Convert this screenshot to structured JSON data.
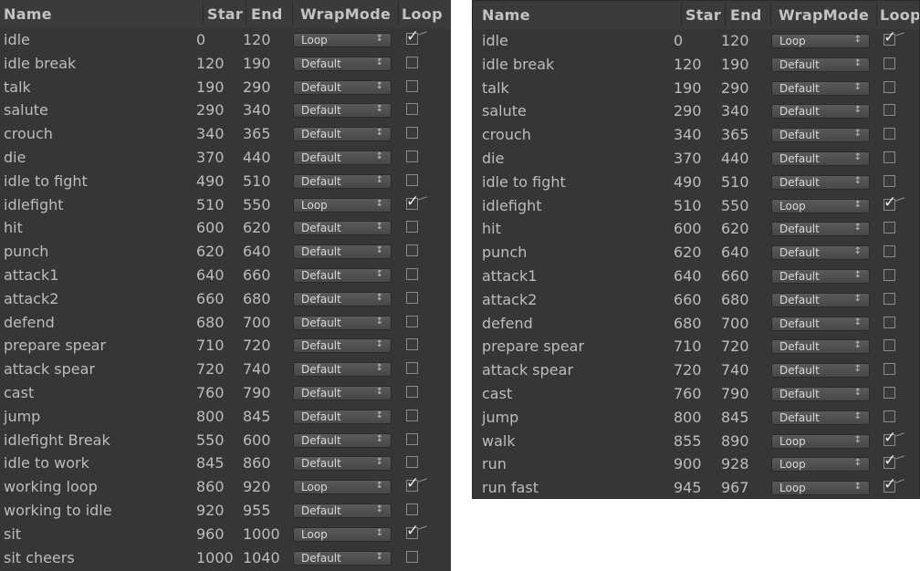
{
  "headers": {
    "name": "Name",
    "start": "Star",
    "end": "End",
    "wrapmode": "WrapMode",
    "loop": "Loop"
  },
  "left_rows": [
    {
      "name": "idle",
      "start": "0",
      "end": "120",
      "wrap": "Loop",
      "loop": true
    },
    {
      "name": "idle break",
      "start": "120",
      "end": "190",
      "wrap": "Default",
      "loop": false
    },
    {
      "name": "talk",
      "start": "190",
      "end": "290",
      "wrap": "Default",
      "loop": false
    },
    {
      "name": "salute",
      "start": "290",
      "end": "340",
      "wrap": "Default",
      "loop": false
    },
    {
      "name": "crouch",
      "start": "340",
      "end": "365",
      "wrap": "Default",
      "loop": false
    },
    {
      "name": "die",
      "start": "370",
      "end": "440",
      "wrap": "Default",
      "loop": false
    },
    {
      "name": "idle to fight",
      "start": "490",
      "end": "510",
      "wrap": "Default",
      "loop": false
    },
    {
      "name": "idlefight",
      "start": "510",
      "end": "550",
      "wrap": "Loop",
      "loop": true
    },
    {
      "name": "hit",
      "start": "600",
      "end": "620",
      "wrap": "Default",
      "loop": false
    },
    {
      "name": "punch",
      "start": "620",
      "end": "640",
      "wrap": "Default",
      "loop": false
    },
    {
      "name": "attack1",
      "start": "640",
      "end": "660",
      "wrap": "Default",
      "loop": false
    },
    {
      "name": "attack2",
      "start": "660",
      "end": "680",
      "wrap": "Default",
      "loop": false
    },
    {
      "name": "defend",
      "start": "680",
      "end": "700",
      "wrap": "Default",
      "loop": false
    },
    {
      "name": "prepare spear",
      "start": "710",
      "end": "720",
      "wrap": "Default",
      "loop": false
    },
    {
      "name": "attack spear",
      "start": "720",
      "end": "740",
      "wrap": "Default",
      "loop": false
    },
    {
      "name": "cast",
      "start": "760",
      "end": "790",
      "wrap": "Default",
      "loop": false
    },
    {
      "name": "jump",
      "start": "800",
      "end": "845",
      "wrap": "Default",
      "loop": false
    },
    {
      "name": "idlefight Break",
      "start": "550",
      "end": "600",
      "wrap": "Default",
      "loop": false
    },
    {
      "name": "idle to work",
      "start": "845",
      "end": "860",
      "wrap": "Default",
      "loop": false
    },
    {
      "name": "working loop",
      "start": "860",
      "end": "920",
      "wrap": "Loop",
      "loop": true
    },
    {
      "name": "working to idle",
      "start": "920",
      "end": "955",
      "wrap": "Default",
      "loop": false
    },
    {
      "name": "sit",
      "start": "960",
      "end": "1000",
      "wrap": "Loop",
      "loop": true
    },
    {
      "name": "sit cheers",
      "start": "1000",
      "end": "1040",
      "wrap": "Default",
      "loop": false
    }
  ],
  "right_rows": [
    {
      "name": "idle",
      "start": "0",
      "end": "120",
      "wrap": "Loop",
      "loop": true
    },
    {
      "name": "idle break",
      "start": "120",
      "end": "190",
      "wrap": "Default",
      "loop": false
    },
    {
      "name": "talk",
      "start": "190",
      "end": "290",
      "wrap": "Default",
      "loop": false
    },
    {
      "name": "salute",
      "start": "290",
      "end": "340",
      "wrap": "Default",
      "loop": false
    },
    {
      "name": "crouch",
      "start": "340",
      "end": "365",
      "wrap": "Default",
      "loop": false
    },
    {
      "name": "die",
      "start": "370",
      "end": "440",
      "wrap": "Default",
      "loop": false
    },
    {
      "name": "idle to fight",
      "start": "490",
      "end": "510",
      "wrap": "Default",
      "loop": false
    },
    {
      "name": "idlefight",
      "start": "510",
      "end": "550",
      "wrap": "Loop",
      "loop": true
    },
    {
      "name": "hit",
      "start": "600",
      "end": "620",
      "wrap": "Default",
      "loop": false
    },
    {
      "name": "punch",
      "start": "620",
      "end": "640",
      "wrap": "Default",
      "loop": false
    },
    {
      "name": "attack1",
      "start": "640",
      "end": "660",
      "wrap": "Default",
      "loop": false
    },
    {
      "name": "attack2",
      "start": "660",
      "end": "680",
      "wrap": "Default",
      "loop": false
    },
    {
      "name": "defend",
      "start": "680",
      "end": "700",
      "wrap": "Default",
      "loop": false
    },
    {
      "name": "prepare spear",
      "start": "710",
      "end": "720",
      "wrap": "Default",
      "loop": false
    },
    {
      "name": "attack spear",
      "start": "720",
      "end": "740",
      "wrap": "Default",
      "loop": false
    },
    {
      "name": "cast",
      "start": "760",
      "end": "790",
      "wrap": "Default",
      "loop": false
    },
    {
      "name": "jump",
      "start": "800",
      "end": "845",
      "wrap": "Default",
      "loop": false
    },
    {
      "name": "walk",
      "start": "855",
      "end": "890",
      "wrap": "Loop",
      "loop": true
    },
    {
      "name": "run",
      "start": "900",
      "end": "928",
      "wrap": "Loop",
      "loop": true
    },
    {
      "name": "run fast",
      "start": "945",
      "end": "967",
      "wrap": "Loop",
      "loop": true
    }
  ],
  "icons": {
    "dropdown": "updown-arrow-icon",
    "checkbox_checked": "checkmark-icon"
  },
  "colors": {
    "panel_bg": "#363636",
    "text": "#bdbdbd",
    "header_text": "#c3c3c3"
  }
}
